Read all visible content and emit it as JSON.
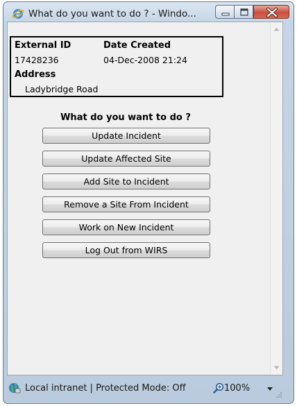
{
  "window": {
    "title": "What do you want to do ? - Windo...",
    "controls": {
      "minimize": "minimize",
      "maximize": "maximize",
      "close": "close"
    }
  },
  "record": {
    "external_id_label": "External ID",
    "external_id": "17428236",
    "date_created_label": "Date Created",
    "date_created": "04-Dec-2008 21:24",
    "address_label": "Address",
    "address": "Ladybridge Road"
  },
  "menu": {
    "heading": "What do you want to do ?",
    "actions": [
      {
        "label": "Update Incident"
      },
      {
        "label": "Update Affected Site"
      },
      {
        "label": "Add Site to Incident"
      },
      {
        "label": "Remove a Site From Incident"
      },
      {
        "label": "Work on New Incident"
      },
      {
        "label": "Log Out from WIRS"
      }
    ]
  },
  "statusbar": {
    "zone": "Local intranet | Protected Mode: Off",
    "zoom": "100%",
    "zone_icon": "globe-icon",
    "zoom_icon": "magnifier-icon"
  }
}
